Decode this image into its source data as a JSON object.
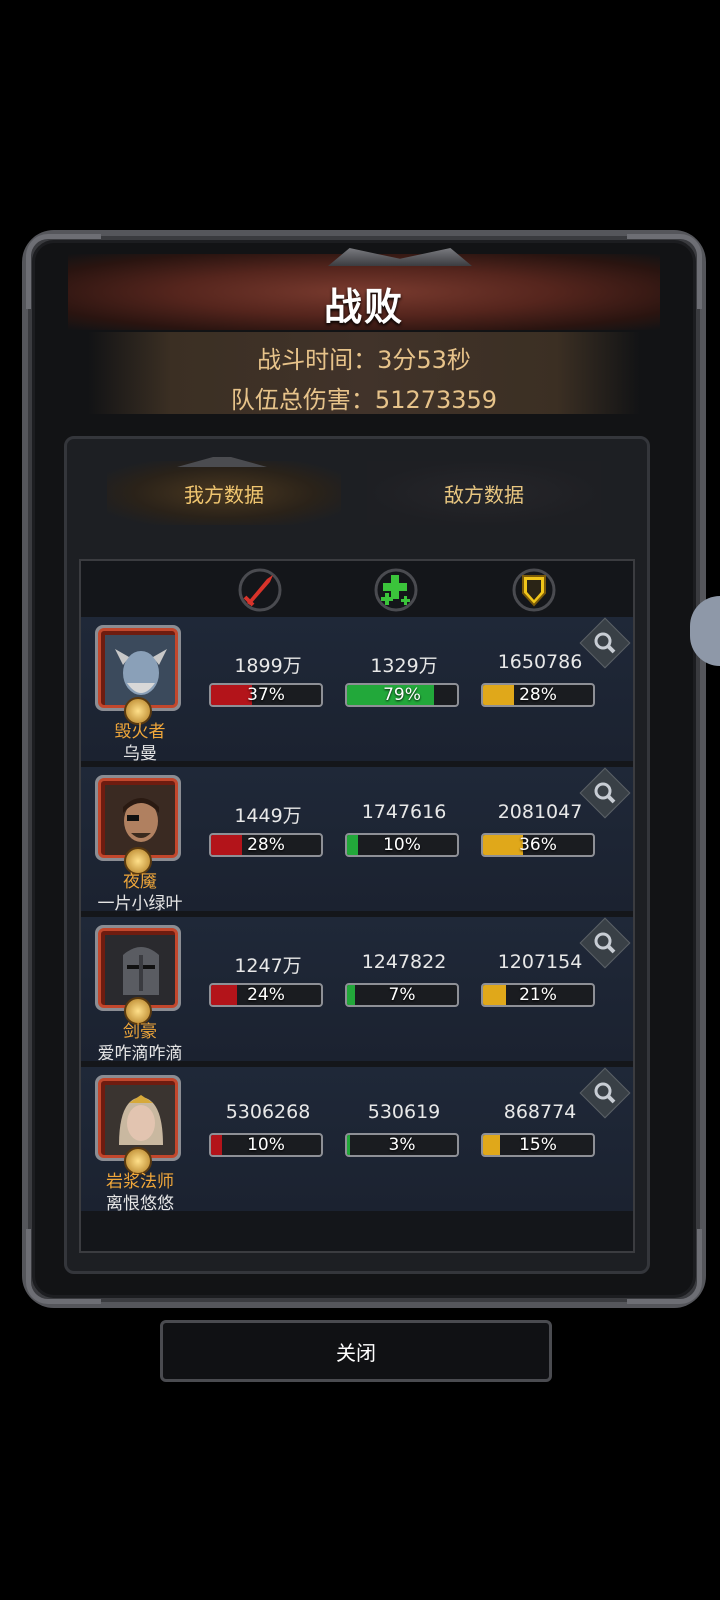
{
  "dialog": {
    "title": "战败",
    "battle_time": "战斗时间：3分53秒",
    "team_damage": "队伍总伤害：51273359"
  },
  "tabs": [
    {
      "label": "我方数据",
      "active": true
    },
    {
      "label": "敌方数据",
      "active": false
    }
  ],
  "columns": [
    {
      "icon": "sword-icon",
      "color": "#d8332a"
    },
    {
      "icon": "heal-cross-icon",
      "color": "#3bc43b"
    },
    {
      "icon": "shield-icon",
      "color": "#f0c51a"
    }
  ],
  "rows": [
    {
      "class": "毁火者",
      "name": "乌曼",
      "damage": "1899万",
      "damage_pct": "37%",
      "damage_frac": 0.37,
      "heal": "1329万",
      "heal_pct": "79%",
      "heal_frac": 0.79,
      "tank": "1650786",
      "tank_pct": "28%",
      "tank_frac": 0.28
    },
    {
      "class": "夜魇",
      "name": "一片小绿叶",
      "damage": "1449万",
      "damage_pct": "28%",
      "damage_frac": 0.28,
      "heal": "1747616",
      "heal_pct": "10%",
      "heal_frac": 0.1,
      "tank": "2081047",
      "tank_pct": "36%",
      "tank_frac": 0.36
    },
    {
      "class": "剑豪",
      "name": "爱咋滴咋滴",
      "damage": "1247万",
      "damage_pct": "24%",
      "damage_frac": 0.24,
      "heal": "1247822",
      "heal_pct": "7%",
      "heal_frac": 0.07,
      "tank": "1207154",
      "tank_pct": "21%",
      "tank_frac": 0.21
    },
    {
      "class": "岩浆法师",
      "name": "离恨悠悠",
      "damage": "5306268",
      "damage_pct": "10%",
      "damage_frac": 0.1,
      "heal": "530619",
      "heal_pct": "3%",
      "heal_frac": 0.03,
      "tank": "868774",
      "tank_pct": "15%",
      "tank_frac": 0.15
    }
  ],
  "bar_colors": {
    "damage": "#b3141a",
    "heal": "#22a83a",
    "tank": "#e0a81a"
  },
  "close_label": "关闭"
}
